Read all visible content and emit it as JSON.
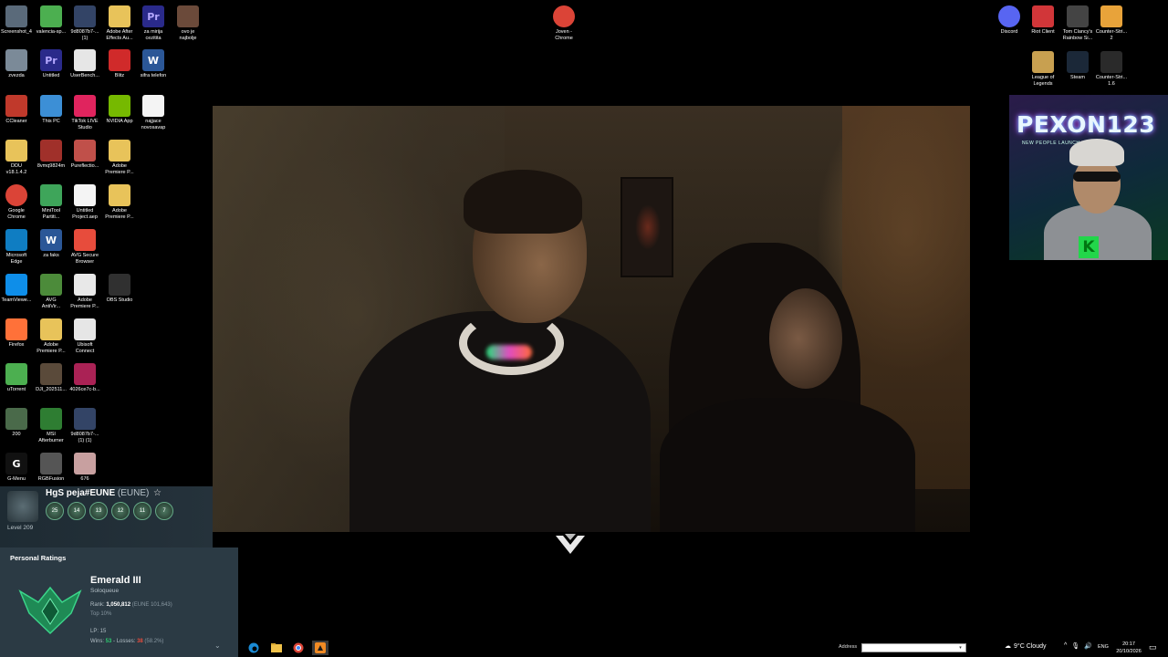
{
  "desktop": {
    "icons": [
      {
        "label": "Screenshot_4",
        "icon": "image-icon",
        "color": "#5a6a7a"
      },
      {
        "label": "valencia-sp...",
        "icon": "image-icon",
        "color": "#4caf50"
      },
      {
        "label": "9d8087b7-...\n(1)",
        "icon": "image-icon",
        "color": "#334466"
      },
      {
        "label": "Adobe After\nEffects Au...",
        "icon": "folder-icon",
        "color": "#e8c35a"
      },
      {
        "label": "za mirija\ncezitita",
        "icon": "premiere-icon",
        "color": "#2a2a8a",
        "glyph": "Pr"
      },
      {
        "label": "ovo je\nnajbolje",
        "icon": "video-icon",
        "color": "#6b4a3a"
      },
      {
        "label": "zvezda",
        "icon": "recycle-bin-icon",
        "color": "#7b8a98"
      },
      {
        "label": "Untitled",
        "icon": "premiere-icon",
        "color": "#2a2a8a",
        "glyph": "Pr"
      },
      {
        "label": "UserBench...",
        "icon": "userbenchmark-icon",
        "color": "#e6e6e6"
      },
      {
        "label": "Blitz",
        "icon": "blitz-icon",
        "color": "#d02a2a"
      },
      {
        "label": "sifra telefon",
        "icon": "word-icon",
        "color": "#2b5797",
        "glyph": "W"
      },
      {
        "label": "CCleaner",
        "icon": "ccleaner-icon",
        "color": "#c0392b"
      },
      {
        "label": "This PC",
        "icon": "computer-icon",
        "color": "#3c8fd6"
      },
      {
        "label": "TikTok LIVE\nStudio",
        "icon": "tiktok-icon",
        "color": "#e0245e"
      },
      {
        "label": "NVIDIA App",
        "icon": "nvidia-icon",
        "color": "#76b900"
      },
      {
        "label": "najjace\nnovosavap",
        "icon": "document-icon",
        "color": "#f4f4f4"
      },
      {
        "label": "DDU\nv18.1.4.2",
        "icon": "folder-icon",
        "color": "#e8c35a"
      },
      {
        "label": "8vmq9824m",
        "icon": "app-icon",
        "color": "#a0302a"
      },
      {
        "label": "Pureflectio...",
        "icon": "app-icon",
        "color": "#c0504a"
      },
      {
        "label": "Adobe\nPremiere P...",
        "icon": "folder-icon",
        "color": "#e8c35a"
      },
      {
        "label": "Google\nChrome",
        "icon": "chrome-icon",
        "color": "#db4437"
      },
      {
        "label": "MiniTool\nPartiti...",
        "icon": "minitool-icon",
        "color": "#3ea55a"
      },
      {
        "label": "Untitled\nProject.aep",
        "icon": "document-icon",
        "color": "#f4f4f4"
      },
      {
        "label": "Adobe\nPremiere P...",
        "icon": "folder-icon",
        "color": "#e8c35a"
      },
      {
        "label": "Microsoft\nEdge",
        "icon": "edge-icon",
        "color": "#0f7dc2"
      },
      {
        "label": "za faks",
        "icon": "word-icon",
        "color": "#2b5797",
        "glyph": "W"
      },
      {
        "label": "AVG Secure\nBrowser",
        "icon": "avg-icon",
        "color": "#e74c3c"
      },
      {
        "label": "TeamViewe...",
        "icon": "teamviewer-icon",
        "color": "#0e8ee9"
      },
      {
        "label": "AVG\nAntiVir...",
        "icon": "avg-icon",
        "color": "#4c8b3a"
      },
      {
        "label": "Adobe\nPremiere P...",
        "icon": "zip-icon",
        "color": "#e8e8e8"
      },
      {
        "label": "OBS Studio",
        "icon": "obs-icon",
        "color": "#303030"
      },
      {
        "label": "Firefox",
        "icon": "firefox-icon",
        "color": "#ff7139"
      },
      {
        "label": "Adobe\nPremiere P...",
        "icon": "folder-icon",
        "color": "#e8c35a"
      },
      {
        "label": "Ubisoft\nConnect",
        "icon": "ubisoft-icon",
        "color": "#e6e6e6"
      },
      {
        "label": "uTorrent",
        "icon": "utorrent-icon",
        "color": "#4caf50"
      },
      {
        "label": "DJI_202511...",
        "icon": "video-icon",
        "color": "#5a4a3a"
      },
      {
        "label": "4026ce7c-b...",
        "icon": "image-icon",
        "color": "#aa2255"
      },
      {
        "label": "200",
        "icon": "image-icon",
        "color": "#4a6a4a"
      },
      {
        "label": "MSI\nAfterburner",
        "icon": "afterburner-icon",
        "color": "#2e7d32"
      },
      {
        "label": "9d8087b7-...\n(1) (1)",
        "icon": "image-icon",
        "color": "#334466"
      },
      {
        "label": "G-Menu",
        "icon": "gmenu-icon",
        "color": "#111111",
        "glyph": "G"
      },
      {
        "label": "RGBFusion",
        "icon": "rgbfusion-icon",
        "color": "#555555"
      },
      {
        "label": "676",
        "icon": "image-icon",
        "color": "#c8a0a0"
      },
      {
        "label": "Joven -\nChrome",
        "icon": "chrome-icon",
        "color": "#db4437"
      },
      {
        "label": "Discord",
        "icon": "discord-icon",
        "color": "#5865f2"
      },
      {
        "label": "Riot Client",
        "icon": "riot-icon",
        "color": "#d13639"
      },
      {
        "label": "Tom Clancy's\nRainbow Si...",
        "icon": "rainbow-six-icon",
        "color": "#444444"
      },
      {
        "label": "Counter-Stri...\n2",
        "icon": "counter-strike-icon",
        "color": "#e8a33a"
      },
      {
        "label": "League of\nLegends",
        "icon": "league-icon",
        "color": "#c8a050"
      },
      {
        "label": "Steam",
        "icon": "steam-icon",
        "color": "#1b2838"
      },
      {
        "label": "Counter-Stri...\n1.6",
        "icon": "counter-strike-icon",
        "color": "#2a2a2a"
      }
    ]
  },
  "webcam": {
    "title": "PEXON123",
    "subtitle": "NEW PEOPLE LAUNCH",
    "badge": "K"
  },
  "lol": {
    "summoner": "HgS peja#EUNE",
    "region": "(EUNE)",
    "level": "Level 209",
    "badges": [
      "25",
      "14",
      "13",
      "12",
      "11",
      "7"
    ],
    "personal_ratings_label": "Personal Ratings",
    "tier": "Emerald III",
    "queue": "Soloqueue",
    "rank_label": "Rank:",
    "rank_value": "1,050,812",
    "rank_region": "(EUNE 101,643)",
    "top": "Top 10%",
    "lp": "LP: 15",
    "wins_label": "Wins:",
    "wins": "53",
    "losses_label": "Losses:",
    "losses": "38",
    "winrate": "(58.2%)"
  },
  "taskbar": {
    "address_label": "Address",
    "address_value": "",
    "weather": "9°C  Cloudy",
    "lang": "ENG",
    "time": "20:17",
    "date": "20/10/2026"
  },
  "colors": {
    "taskbar_bg": "#000000",
    "lol_panel_bg": "#2b3a44",
    "win_color": "#2ecc71",
    "loss_color": "#e74c3c"
  }
}
